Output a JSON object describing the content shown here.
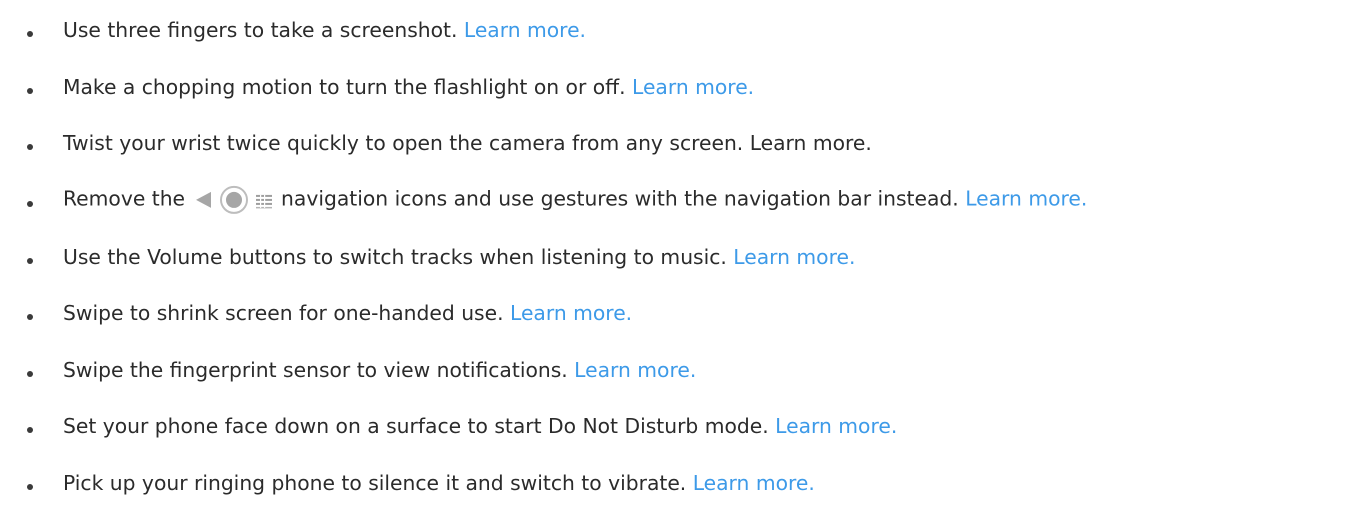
{
  "items": [
    {
      "text": "Use three fingers to take a screenshot. ",
      "link": "Learn more."
    },
    {
      "text": "Make a chopping motion to turn the flashlight on or off. ",
      "link": "Learn more."
    },
    {
      "text": "Twist your wrist twice quickly to open the camera from any screen. ",
      "link": "Learn more."
    },
    {
      "text_before": "Remove the",
      "text_after": "navigation icons and use gestures with the navigation bar instead. ",
      "link": "Learn more."
    },
    {
      "text": "Use the Volume buttons to switch tracks when listening to music. ",
      "link": "Learn more."
    },
    {
      "text": "Swipe to shrink screen for one-handed use. ",
      "link": "Learn more."
    },
    {
      "text": "Swipe the fingerprint sensor to view notifications. ",
      "link": "Learn more."
    },
    {
      "text": "Set your phone face down on a surface to start Do Not Disturb mode. ",
      "link": "Learn more."
    },
    {
      "text": "Pick up your ringing phone to silence it and switch to vibrate. ",
      "link": "Learn more."
    }
  ],
  "icons": {
    "nav_icons": [
      "back-icon",
      "home-icon",
      "recents-icon"
    ]
  },
  "colors": {
    "link": "#3d9ae8",
    "text": "#2b2b2b"
  }
}
